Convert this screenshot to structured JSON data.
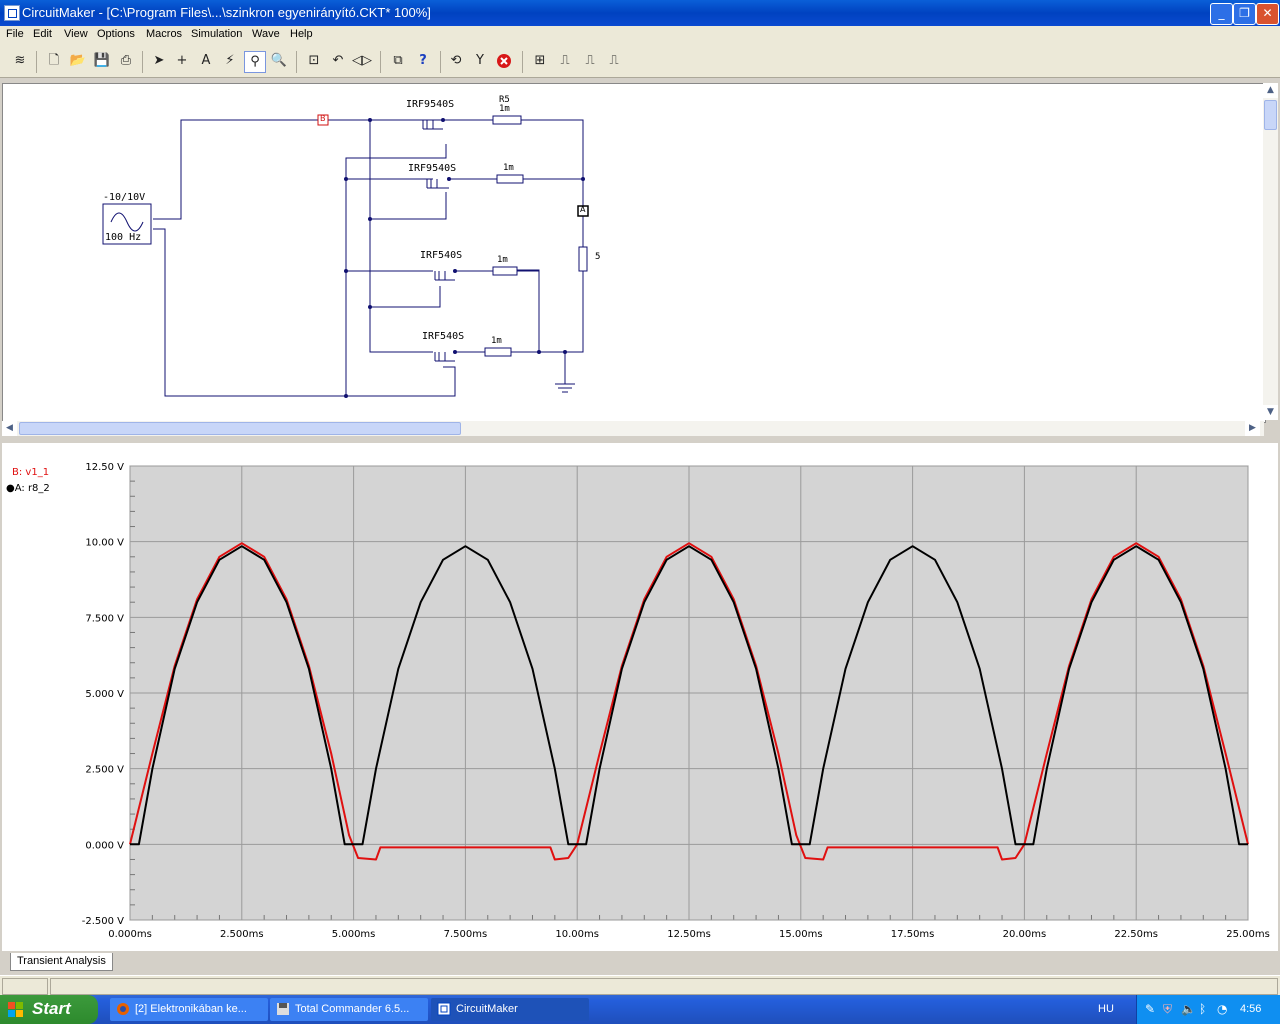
{
  "window": {
    "title": "CircuitMaker - [C:\\Program Files\\...\\szinkron egyenirányító.CKT* 100%]",
    "controls": {
      "minimize": "_",
      "maximize": "❐",
      "close": "✕"
    }
  },
  "menu": [
    "File",
    "Edit",
    "View",
    "Options",
    "Macros",
    "Simulation",
    "Wave",
    "Help"
  ],
  "toolbar": {
    "icons": [
      "scroll-icon",
      "new-file-icon",
      "open-folder-icon",
      "save-icon",
      "print-icon",
      "arrow-tool-icon",
      "wire-tool-icon",
      "text-tool-icon",
      "probe-tool-icon",
      "zoom-probe-icon",
      "magnify-icon",
      "zoom-window-icon",
      "rotate-icon",
      "mirror-icon",
      "digital-sim-icon",
      "help-icon",
      "reset-icon",
      "step-icon",
      "stop-icon",
      "waveform-window-icon",
      "analog-wave-icon",
      "digital-wave-icon",
      "trace-icon"
    ],
    "active": "zoom-probe-icon"
  },
  "schematic": {
    "source_label": "-10/10V",
    "source_freq": "100 Hz",
    "mosfets": [
      "IRF9540S",
      "IRF9540S",
      "IRF540S",
      "IRF540S"
    ],
    "resistors": [
      "R5",
      "1m",
      "1m",
      "1m",
      "1m"
    ],
    "load_label": "5",
    "probe_b": "B",
    "probe_a": "A"
  },
  "legend": {
    "b": "B: v1_1",
    "a": "A: r8_2",
    "b_color": "#e01010",
    "a_color": "#000000"
  },
  "colors": {
    "plot_bg": "#d4d4d4",
    "grid": "#9a9a9a",
    "window_blue": "#0042c0"
  },
  "chart_data": {
    "type": "line",
    "title": "",
    "xlabel": "",
    "ylabel": "",
    "xlim": [
      0,
      25
    ],
    "ylim": [
      -2.5,
      12.5
    ],
    "x_unit": "ms",
    "y_unit": "V",
    "x_ticks": [
      "0.000ms",
      "2.500ms",
      "5.000ms",
      "7.500ms",
      "10.00ms",
      "12.50ms",
      "15.00ms",
      "17.50ms",
      "20.00ms",
      "22.50ms",
      "25.00ms"
    ],
    "y_ticks": [
      "12.50 V",
      "10.00 V",
      "7.500 V",
      "5.000 V",
      "2.500 V",
      "0.000 V",
      "-2.500 V"
    ],
    "grid": true,
    "legend_position": "top-left",
    "series": [
      {
        "name": "B: v1_1",
        "color": "#e01010",
        "x": [
          0,
          0.5,
          1.0,
          1.5,
          2.0,
          2.5,
          3.0,
          3.5,
          4.0,
          4.5,
          4.9,
          5.1,
          5.5,
          5.6,
          6.0,
          9.0,
          9.4,
          9.5,
          9.8,
          10.0,
          10.5,
          11.0,
          11.5,
          12.0,
          12.5,
          13.0,
          13.5,
          14.0,
          14.5,
          14.9,
          15.1,
          15.5,
          15.6,
          16.0,
          19.0,
          19.4,
          19.5,
          19.8,
          20.0,
          20.5,
          21.0,
          21.5,
          22.0,
          22.5,
          23.0,
          23.5,
          24.0,
          24.5,
          25.0
        ],
        "y": [
          0,
          3.0,
          5.9,
          8.1,
          9.5,
          9.95,
          9.5,
          8.1,
          5.9,
          3.0,
          0.3,
          -0.45,
          -0.5,
          -0.1,
          -0.1,
          -0.1,
          -0.1,
          -0.5,
          -0.45,
          0.0,
          3.0,
          5.9,
          8.1,
          9.5,
          9.95,
          9.5,
          8.1,
          5.9,
          3.0,
          0.3,
          -0.45,
          -0.5,
          -0.1,
          -0.1,
          -0.1,
          -0.1,
          -0.5,
          -0.45,
          0.0,
          3.0,
          5.9,
          8.1,
          9.5,
          9.95,
          9.5,
          8.1,
          5.9,
          3.0,
          0.0
        ]
      },
      {
        "name": "A: r8_2",
        "color": "#000000",
        "x": [
          0,
          0.2,
          0.5,
          1.0,
          1.5,
          2.0,
          2.5,
          3.0,
          3.5,
          4.0,
          4.5,
          4.8,
          5.0,
          5.2,
          5.5,
          6.0,
          6.5,
          7.0,
          7.5,
          8.0,
          8.5,
          9.0,
          9.5,
          9.8,
          10.0,
          10.2,
          10.5,
          11.0,
          11.5,
          12.0,
          12.5,
          13.0,
          13.5,
          14.0,
          14.5,
          14.8,
          15.0,
          15.2,
          15.5,
          16.0,
          16.5,
          17.0,
          17.5,
          18.0,
          18.5,
          19.0,
          19.5,
          19.8,
          20.0,
          20.2,
          20.5,
          21.0,
          21.5,
          22.0,
          22.5,
          23.0,
          23.5,
          24.0,
          24.5,
          24.8,
          25.0
        ],
        "y": [
          0,
          0,
          2.5,
          5.8,
          8.0,
          9.4,
          9.85,
          9.4,
          8.0,
          5.8,
          2.5,
          0,
          0,
          0,
          2.5,
          5.8,
          8.0,
          9.4,
          9.85,
          9.4,
          8.0,
          5.8,
          2.5,
          0,
          0,
          0,
          2.5,
          5.8,
          8.0,
          9.4,
          9.85,
          9.4,
          8.0,
          5.8,
          2.5,
          0,
          0,
          0,
          2.5,
          5.8,
          8.0,
          9.4,
          9.85,
          9.4,
          8.0,
          5.8,
          2.5,
          0,
          0,
          0,
          2.5,
          5.8,
          8.0,
          9.4,
          9.85,
          9.4,
          8.0,
          5.8,
          2.5,
          0,
          0
        ]
      }
    ]
  },
  "tabs": [
    "Transient Analysis"
  ],
  "taskbar": {
    "start": "Start",
    "tasks": [
      "[2] Elektronikában ke...",
      "Total Commander 6.5...",
      "CircuitMaker"
    ],
    "lang": "HU",
    "clock": "4:56"
  }
}
